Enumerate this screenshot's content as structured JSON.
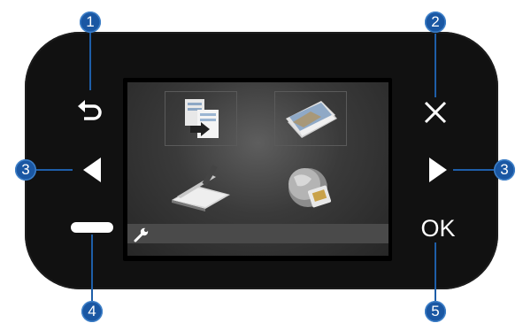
{
  "controls": {
    "back_icon": "undo-arrow",
    "cancel_icon": "x-mark",
    "left_icon": "triangle-left",
    "right_icon": "triangle-right",
    "select_icon": "horizontal-bar",
    "ok_label": "OK"
  },
  "screen": {
    "tiles": [
      {
        "icon": "copy-icon"
      },
      {
        "icon": "photo-icon"
      },
      {
        "icon": "scan-icon"
      },
      {
        "icon": "web-globe-icon"
      }
    ],
    "settings_icon": "wrench-icon"
  },
  "callouts": {
    "back": "1",
    "cancel": "2",
    "arrow_left": "3",
    "arrow_right": "3",
    "select": "4",
    "ok": "5"
  },
  "colors": {
    "panel": "#111111",
    "callout": "#1a57a3",
    "screen_center": "#5e5e5e",
    "settings_bar": "#4a4a4a"
  }
}
